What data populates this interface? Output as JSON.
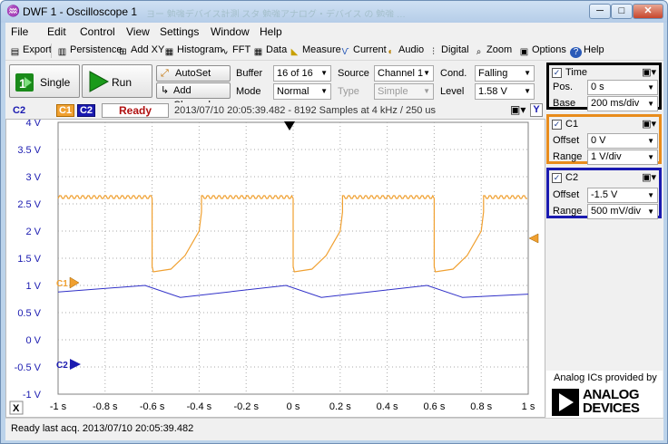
{
  "window": {
    "title": "DWF 1 - Oscilloscope 1",
    "background_ghost_text": "ヨー 勉強デバイス計測 スタ 勉強アナログ・デバイス の 勉強 …",
    "buttons": {
      "minimize": "─",
      "maximize": "□",
      "close": "✕"
    }
  },
  "menu": [
    "File",
    "Edit",
    "Control",
    "View",
    "Settings",
    "Window",
    "Help"
  ],
  "toolbar": [
    {
      "label": "Export",
      "icon": "export-icon"
    },
    {
      "label": "Persistence",
      "icon": "persistence-icon"
    },
    {
      "label": "Add XY",
      "icon": "add-xy-icon"
    },
    {
      "label": "Histogram",
      "icon": "histogram-icon"
    },
    {
      "label": "FFT",
      "icon": "fft-icon"
    },
    {
      "label": "Data",
      "icon": "data-icon"
    },
    {
      "label": "Measure",
      "icon": "measure-icon"
    },
    {
      "label": "Current",
      "icon": "current-icon"
    },
    {
      "label": "Audio",
      "icon": "audio-icon"
    },
    {
      "label": "Digital",
      "icon": "digital-icon"
    },
    {
      "label": "Zoom",
      "icon": "zoom-icon"
    },
    {
      "label": "Options",
      "icon": "options-icon"
    },
    {
      "label": "Help",
      "icon": "help-icon"
    }
  ],
  "controls": {
    "single_label": "Single",
    "run_label": "Run",
    "autoset_label": "AutoSet",
    "add_channel_label": "Add Channel",
    "buffer_label": "Buffer",
    "buffer_value": "16 of 16",
    "mode_label": "Mode",
    "mode_value": "Normal",
    "source_label": "Source",
    "source_value": "Channel 1",
    "type_label": "Type",
    "type_value": "Simple",
    "cond_label": "Cond.",
    "cond_value": "Falling",
    "level_label": "Level",
    "level_value": "1.58 V"
  },
  "plot_header": {
    "ch_label": "C2",
    "c1_tag": "C1",
    "c2_tag": "C2",
    "state": "Ready",
    "info": "2013/07/10  20:05:39.482 - 8192 Samples at 4 kHz / 250 us",
    "y_button": "Y",
    "x_button": "X"
  },
  "y_ticks": [
    "4 V",
    "3.5 V",
    "3 V",
    "2.5 V",
    "2 V",
    "1.5 V",
    "1 V",
    "0.5 V",
    "0 V",
    "-0.5 V",
    "-1 V"
  ],
  "x_ticks": [
    "-1 s",
    "-0.8 s",
    "-0.6 s",
    "-0.4 s",
    "-0.2 s",
    "0 s",
    "0.2 s",
    "0.4 s",
    "0.6 s",
    "0.8 s",
    "1 s"
  ],
  "markers": {
    "c1": "C1",
    "c2": "C2"
  },
  "colors": {
    "c1": "#f0a030",
    "c2": "#2a2ad0",
    "time_panel": "#000000",
    "c1_panel": "#e88c1c",
    "c2_panel": "#1a1ab0",
    "ready": "#b01010"
  },
  "time_panel": {
    "title": "Time",
    "pos_label": "Pos.",
    "pos_value": "0 s",
    "base_label": "Base",
    "base_value": "200 ms/div"
  },
  "c1_panel": {
    "title": "C1",
    "offset_label": "Offset",
    "offset_value": "0 V",
    "range_label": "Range",
    "range_value": "1 V/div"
  },
  "c2_panel": {
    "title": "C2",
    "offset_label": "Offset",
    "offset_value": "-1.5 V",
    "range_label": "Range",
    "range_value": "500 mV/div"
  },
  "branding": {
    "caption": "Analog ICs provided by",
    "logo_line1": "ANALOG",
    "logo_line2": "DEVICES"
  },
  "status": "Ready last acq. 2013/07/10  20:05:39.482"
}
